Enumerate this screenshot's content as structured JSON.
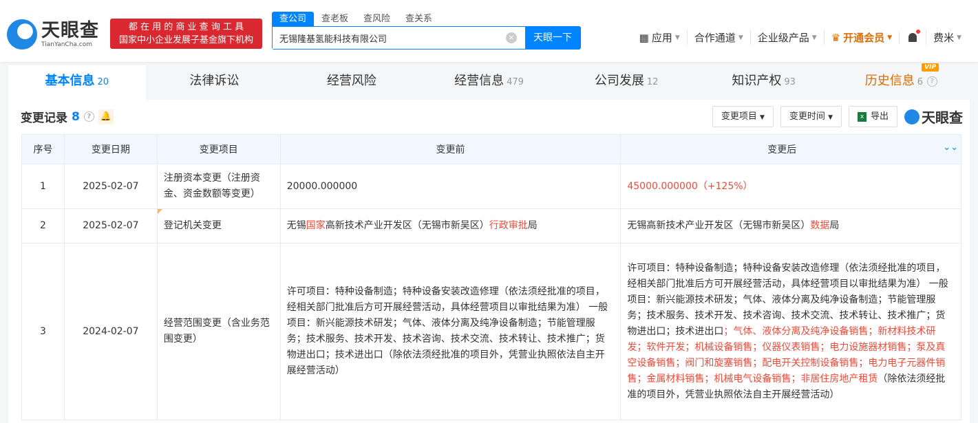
{
  "header": {
    "logo_cn": "天眼查",
    "logo_en": "TianYanCha.com",
    "slogan_line1": "都 在 用 的 商 业 查 询 工 具",
    "slogan_line2": "国家中小企业发展子基金旗下机构",
    "search_tabs": [
      "查公司",
      "查老板",
      "查风险",
      "查关系"
    ],
    "search_value": "无锡隆基氢能科技有限公司",
    "search_button": "天眼一下",
    "nav": {
      "apps": "应用",
      "partner": "合作通道",
      "enterprise": "企业级产品",
      "vip": "开通会员",
      "user": "费米"
    }
  },
  "tabs": [
    {
      "label": "基本信息",
      "count": "20"
    },
    {
      "label": "法律诉讼",
      "count": ""
    },
    {
      "label": "经营风险",
      "count": ""
    },
    {
      "label": "经营信息",
      "count": "479"
    },
    {
      "label": "公司发展",
      "count": "12"
    },
    {
      "label": "知识产权",
      "count": "93"
    },
    {
      "label": "历史信息",
      "count": "6",
      "badge": "VIP"
    }
  ],
  "section": {
    "title": "变更记录",
    "count": "8",
    "filter_item": "变更项目",
    "filter_time": "变更时间",
    "export": "导出",
    "brand": "天眼查"
  },
  "table": {
    "headers": [
      "序号",
      "变更日期",
      "变更项目",
      "变更前",
      "变更后"
    ],
    "rows": [
      {
        "no": "1",
        "date": "2025-02-07",
        "item": "注册资本变更（注册资金、资金数额等变更）",
        "before": [
          {
            "t": "20000.000000",
            "hl": false
          }
        ],
        "after": [
          {
            "t": "45000.000000（+125%）",
            "hl": true
          }
        ]
      },
      {
        "no": "2",
        "date": "2025-02-07",
        "item": "登记机关变更",
        "before": [
          {
            "t": "无锡",
            "hl": false
          },
          {
            "t": "国家",
            "hl": true
          },
          {
            "t": "高新技术产业开发区（无锡市新吴区）",
            "hl": false
          },
          {
            "t": "行政审批",
            "hl": true
          },
          {
            "t": "局",
            "hl": false
          }
        ],
        "after": [
          {
            "t": "无锡高新技术产业开发区（无锡市新吴区）",
            "hl": false
          },
          {
            "t": "数据",
            "hl": true
          },
          {
            "t": "局",
            "hl": false
          }
        ]
      },
      {
        "no": "3",
        "date": "2024-02-07",
        "item": "经营范围变更（含业务范围变更）",
        "before": [
          {
            "t": "许可项目：特种设备制造；特种设备安装改造修理（依法须经批准的项目，经相关部门批准后方可开展经营活动，具体经营项目以审批结果为准） 一般项目：新兴能源技术研发；气体、液体分离及纯净设备制造；节能管理服务；技术服务、技术开发、技术咨询、技术交流、技术转让、技术推广；货物进出口；技术进出口（除依法须经批准的项目外，凭营业执照依法自主开展经营活动）",
            "hl": false
          }
        ],
        "after": [
          {
            "t": "许可项目：特种设备制造；特种设备安装改造修理（依法须经批准的项目，经相关部门批准后方可开展经营活动，具体经营项目以审批结果为准） 一般项目：新兴能源技术研发；气体、液体分离及纯净设备制造；节能管理服务；技术服务、技术开发、技术咨询、技术交流、技术转让、技术推广；货物进出口；技术进出口",
            "hl": false
          },
          {
            "t": "；气体、液体分离及纯净设备销售；新材料技术研发；软件开发；机械设备销售；仪器仪表销售；电力设施器材销售；泵及真空设备销售；阀门和旋塞销售；配电开关控制设备销售；电力电子元器件销售；金属材料销售；机械电气设备销售；非居住房地产租赁",
            "hl": true
          },
          {
            "t": "（除依法须经批准的项目外，凭营业执照依法自主开展经营活动）",
            "hl": false
          }
        ]
      }
    ]
  }
}
